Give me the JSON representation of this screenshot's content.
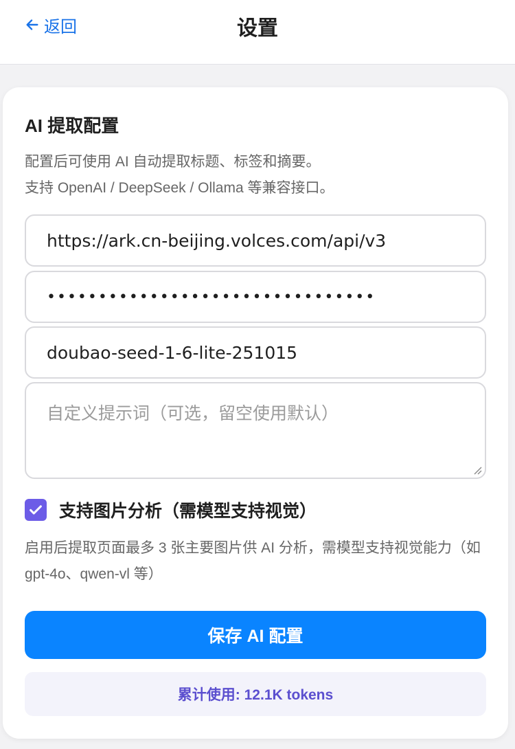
{
  "header": {
    "back_label": "返回",
    "title": "设置"
  },
  "ai_config": {
    "section_title": "AI 提取配置",
    "description_line1": "配置后可使用 AI 自动提取标题、标签和摘要。",
    "description_line2": "支持 OpenAI / DeepSeek / Ollama 等兼容接口。",
    "api_url": "https://ark.cn-beijing.volces.com/api/v3",
    "api_key_masked": "••••••••••••••••••••••••••••••••",
    "model": "doubao-seed-1-6-lite-251015",
    "prompt_placeholder": "自定义提示词（可选，留空使用默认）",
    "vision_checkbox_label": "支持图片分析（需模型支持视觉）",
    "vision_checked": true,
    "vision_hint": "启用后提取页面最多 3 张主要图片供 AI 分析，需模型支持视觉能力（如 gpt-4o、qwen-vl 等）",
    "save_button": "保存 AI 配置",
    "usage": "累计使用: 12.1K tokens"
  },
  "colors": {
    "accent": "#0a84ff",
    "checkbox": "#6c5ce7",
    "usage_text": "#5b4fcf"
  }
}
